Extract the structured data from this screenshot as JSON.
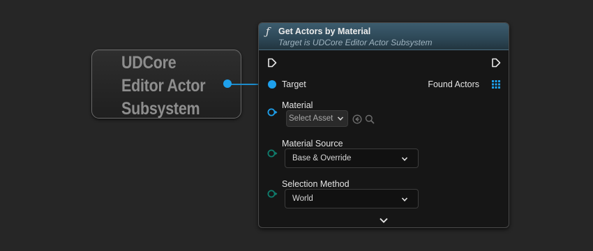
{
  "variable_node": {
    "lines": [
      "UDCore",
      "Editor Actor",
      "Subsystem"
    ]
  },
  "function_node": {
    "icon": "function-icon",
    "title": "Get Actors by Material",
    "subtitle": "Target is UDCore Editor Actor Subsystem",
    "inputs": {
      "target_label": "Target",
      "material_label": "Material",
      "material_placeholder": "Select Asset",
      "material_source_label": "Material Source",
      "material_source_value": "Base & Override",
      "selection_method_label": "Selection Method",
      "selection_method_value": "World"
    },
    "outputs": {
      "found_actors_label": "Found Actors"
    }
  },
  "colors": {
    "object_pin": "#1ea0ec",
    "enum_pin": "#0f7d6d",
    "header": "#2d4756",
    "background": "#262626"
  }
}
